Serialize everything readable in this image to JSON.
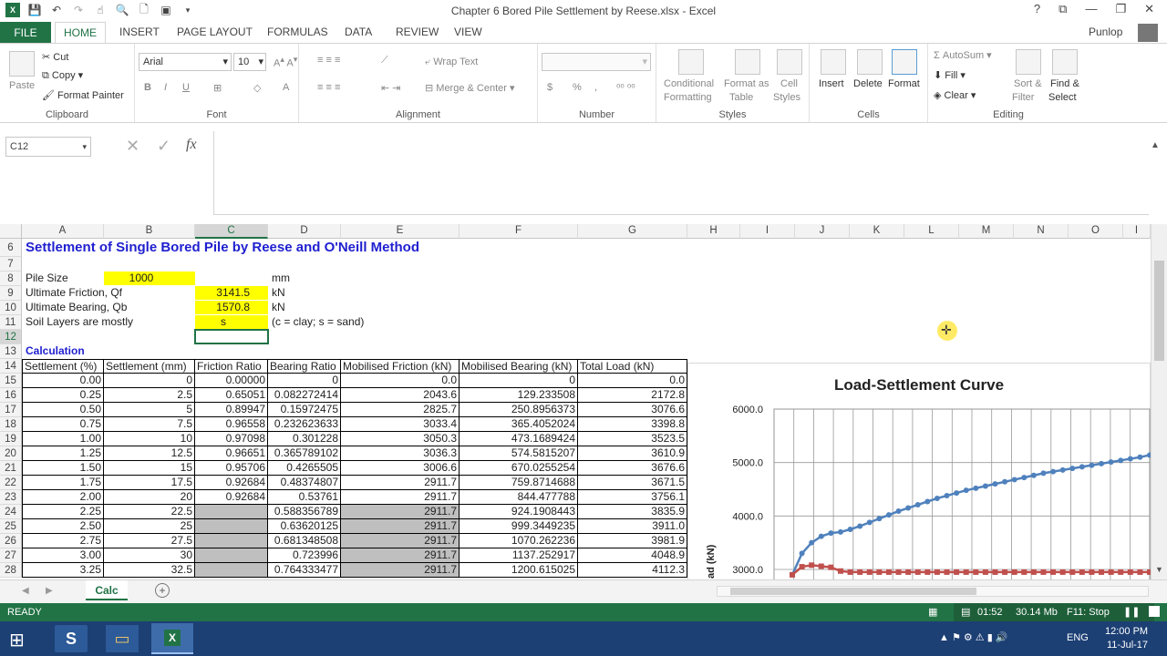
{
  "window": {
    "title": "Chapter 6 Bored Pile Settlement by Reese.xlsx - Excel",
    "user": "Punlop",
    "controls": [
      "?",
      "⧉",
      "—",
      "❐",
      "✕"
    ]
  },
  "tabs": [
    "FILE",
    "HOME",
    "INSERT",
    "PAGE LAYOUT",
    "FORMULAS",
    "DATA",
    "REVIEW",
    "VIEW"
  ],
  "ribbon": {
    "clipboard": {
      "label": "Clipboard",
      "paste": "Paste",
      "cut": "Cut",
      "copy": "Copy",
      "format_painter": "Format Painter"
    },
    "font": {
      "label": "Font",
      "name": "Arial",
      "size": "10",
      "bold": "B",
      "italic": "I",
      "underline": "U"
    },
    "alignment": {
      "label": "Alignment",
      "wrap": "Wrap Text",
      "merge": "Merge & Center"
    },
    "number": {
      "label": "Number",
      "currency": "$",
      "percent": "%",
      "comma": ","
    },
    "styles": {
      "label": "Styles",
      "cond": "Conditional",
      "cond2": "Formatting",
      "fmt_table": "Format as",
      "fmt_table2": "Table",
      "cell_styles": "Cell",
      "cell_styles2": "Styles"
    },
    "cells": {
      "label": "Cells",
      "insert": "Insert",
      "delete": "Delete",
      "format": "Format"
    },
    "editing": {
      "label": "Editing",
      "autosum": "AutoSum",
      "fill": "Fill",
      "clear": "Clear",
      "sort": "Sort &",
      "sort2": "Filter",
      "find": "Find &",
      "find2": "Select"
    }
  },
  "namebox": "C12",
  "fx": "fx",
  "columns": [
    "A",
    "B",
    "C",
    "D",
    "E",
    "F",
    "G",
    "H",
    "I",
    "J",
    "K",
    "L",
    "M",
    "N",
    "O",
    "I"
  ],
  "title": "Settlement of Single Bored Pile by Reese and O'Neill Method",
  "inputs": [
    {
      "row": "8",
      "label": "Pile Size",
      "value": "1000",
      "unit": "mm"
    },
    {
      "row": "9",
      "label": "Ultimate Friction, Qf",
      "value": "3141.5",
      "unit": "kN"
    },
    {
      "row": "10",
      "label": "Ultimate Bearing, Qb",
      "value": "1570.8",
      "unit": "kN"
    },
    {
      "row": "11",
      "label": "Soil Layers are mostly",
      "value": "s",
      "unit": "(c = clay; s = sand)"
    }
  ],
  "calc_label": "Calculation",
  "table_headers": [
    "Settlement (%)",
    "Settlement (mm)",
    "Friction Ratio",
    "Bearing Ratio",
    "Mobilised Friction (kN)",
    "Mobilised Bearing (kN)",
    "Total Load (kN)"
  ],
  "table_rows": [
    {
      "row": "15",
      "a": "0.00",
      "b": "0",
      "c": "0.00000",
      "d": "0",
      "e": "0.0",
      "f": "0",
      "g": "0.0"
    },
    {
      "row": "16",
      "a": "0.25",
      "b": "2.5",
      "c": "0.65051",
      "d": "0.082272414",
      "e": "2043.6",
      "f": "129.233508",
      "g": "2172.8"
    },
    {
      "row": "17",
      "a": "0.50",
      "b": "5",
      "c": "0.89947",
      "d": "0.15972475",
      "e": "2825.7",
      "f": "250.8956373",
      "g": "3076.6"
    },
    {
      "row": "18",
      "a": "0.75",
      "b": "7.5",
      "c": "0.96558",
      "d": "0.232623633",
      "e": "3033.4",
      "f": "365.4052024",
      "g": "3398.8"
    },
    {
      "row": "19",
      "a": "1.00",
      "b": "10",
      "c": "0.97098",
      "d": "0.301228",
      "e": "3050.3",
      "f": "473.1689424",
      "g": "3523.5"
    },
    {
      "row": "20",
      "a": "1.25",
      "b": "12.5",
      "c": "0.96651",
      "d": "0.365789102",
      "e": "3036.3",
      "f": "574.5815207",
      "g": "3610.9"
    },
    {
      "row": "21",
      "a": "1.50",
      "b": "15",
      "c": "0.95706",
      "d": "0.4265505",
      "e": "3006.6",
      "f": "670.0255254",
      "g": "3676.6"
    },
    {
      "row": "22",
      "a": "1.75",
      "b": "17.5",
      "c": "0.92684",
      "d": "0.48374807",
      "e": "2911.7",
      "f": "759.8714688",
      "g": "3671.5"
    },
    {
      "row": "23",
      "a": "2.00",
      "b": "20",
      "c": "0.92684",
      "d": "0.53761",
      "e": "2911.7",
      "f": "844.477788",
      "g": "3756.1"
    },
    {
      "row": "24",
      "a": "2.25",
      "b": "22.5",
      "c": "",
      "d": "0.588356789",
      "e": "2911.7",
      "f": "924.1908443",
      "g": "3835.9"
    },
    {
      "row": "25",
      "a": "2.50",
      "b": "25",
      "c": "",
      "d": "0.63620125",
      "e": "2911.7",
      "f": "999.3449235",
      "g": "3911.0"
    },
    {
      "row": "26",
      "a": "2.75",
      "b": "27.5",
      "c": "",
      "d": "0.681348508",
      "e": "2911.7",
      "f": "1070.262236",
      "g": "3981.9"
    },
    {
      "row": "27",
      "a": "3.00",
      "b": "30",
      "c": "",
      "d": "0.723996",
      "e": "2911.7",
      "f": "1137.252917",
      "g": "4048.9"
    },
    {
      "row": "28",
      "a": "3.25",
      "b": "32.5",
      "c": "",
      "d": "0.764333477",
      "e": "2911.7",
      "f": "1200.615025",
      "g": "4112.3"
    }
  ],
  "chart_data": {
    "type": "line",
    "title": "Load-Settlement Curve",
    "ylabel": "ad (kN)",
    "y_ticks": [
      "6000.0",
      "5000.0",
      "4000.0",
      "3000.0"
    ],
    "ylim": [
      3000,
      6000
    ],
    "series": [
      {
        "color": "#4f81bd",
        "marker": "circle",
        "values": [
          2900,
          3300,
          3500,
          3620,
          3680,
          3700,
          3750,
          3810,
          3880,
          3950,
          4020,
          4090,
          4150,
          4210,
          4270,
          4330,
          4380,
          4430,
          4480,
          4520,
          4560,
          4600,
          4640,
          4680,
          4720,
          4760,
          4800,
          4830,
          4860,
          4890,
          4920,
          4950,
          4980,
          5010,
          5040,
          5070,
          5100,
          5140
        ]
      },
      {
        "color": "#c0504d",
        "marker": "square",
        "values": [
          2900,
          3050,
          3080,
          3060,
          3040,
          2970,
          2950,
          2950,
          2950,
          2950,
          2950,
          2950,
          2950,
          2950,
          2950,
          2950,
          2950,
          2950,
          2950,
          2950,
          2950,
          2950,
          2950,
          2950,
          2950,
          2950,
          2950,
          2950,
          2950,
          2950,
          2950,
          2950,
          2950,
          2950,
          2950,
          2950,
          2950,
          2950
        ]
      }
    ]
  },
  "sheet_tab": "Calc",
  "status": {
    "ready": "READY",
    "time": "01:52",
    "mem": "30.14 Mb",
    "f11": "F11: Stop"
  },
  "taskbar": {
    "lang": "ENG",
    "clock": "12:00 PM",
    "date": "11-Jul-17"
  }
}
